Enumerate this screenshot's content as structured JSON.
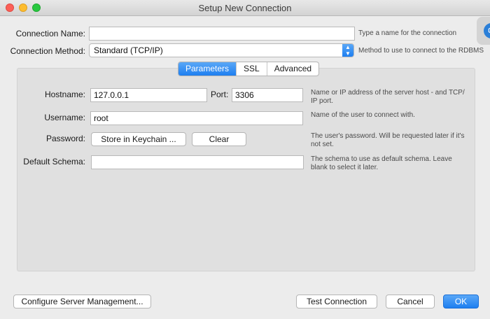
{
  "window": {
    "title": "Setup New Connection"
  },
  "form": {
    "connection_name": {
      "label": "Connection Name:",
      "value": "",
      "hint": "Type a name for the connection"
    },
    "connection_method": {
      "label": "Connection Method:",
      "value": "Standard (TCP/IP)",
      "hint": "Method to use to connect to the RDBMS"
    }
  },
  "tabs": [
    {
      "label": "Parameters",
      "active": true
    },
    {
      "label": "SSL",
      "active": false
    },
    {
      "label": "Advanced",
      "active": false
    }
  ],
  "params": {
    "hostname": {
      "label": "Hostname:",
      "value": "127.0.0.1"
    },
    "port": {
      "label": "Port:",
      "value": "3306",
      "hint": "Name or IP address of the server host - and TCP/ IP port."
    },
    "username": {
      "label": "Username:",
      "value": "root",
      "hint": "Name of the user to connect with."
    },
    "password": {
      "label": "Password:",
      "store_button": "Store in Keychain ...",
      "clear_button": "Clear",
      "hint": "The user's password. Will be requested later if it's not set."
    },
    "default_schema": {
      "label": "Default Schema:",
      "value": "",
      "hint": "The schema to use as default schema. Leave blank to select it later."
    }
  },
  "footer": {
    "configure_button": "Configure Server Management...",
    "test_button": "Test Connection",
    "cancel_button": "Cancel",
    "ok_button": "OK"
  },
  "colors": {
    "accent": "#1e7ff0",
    "panel": "#e0e0e0",
    "window": "#ececec"
  }
}
